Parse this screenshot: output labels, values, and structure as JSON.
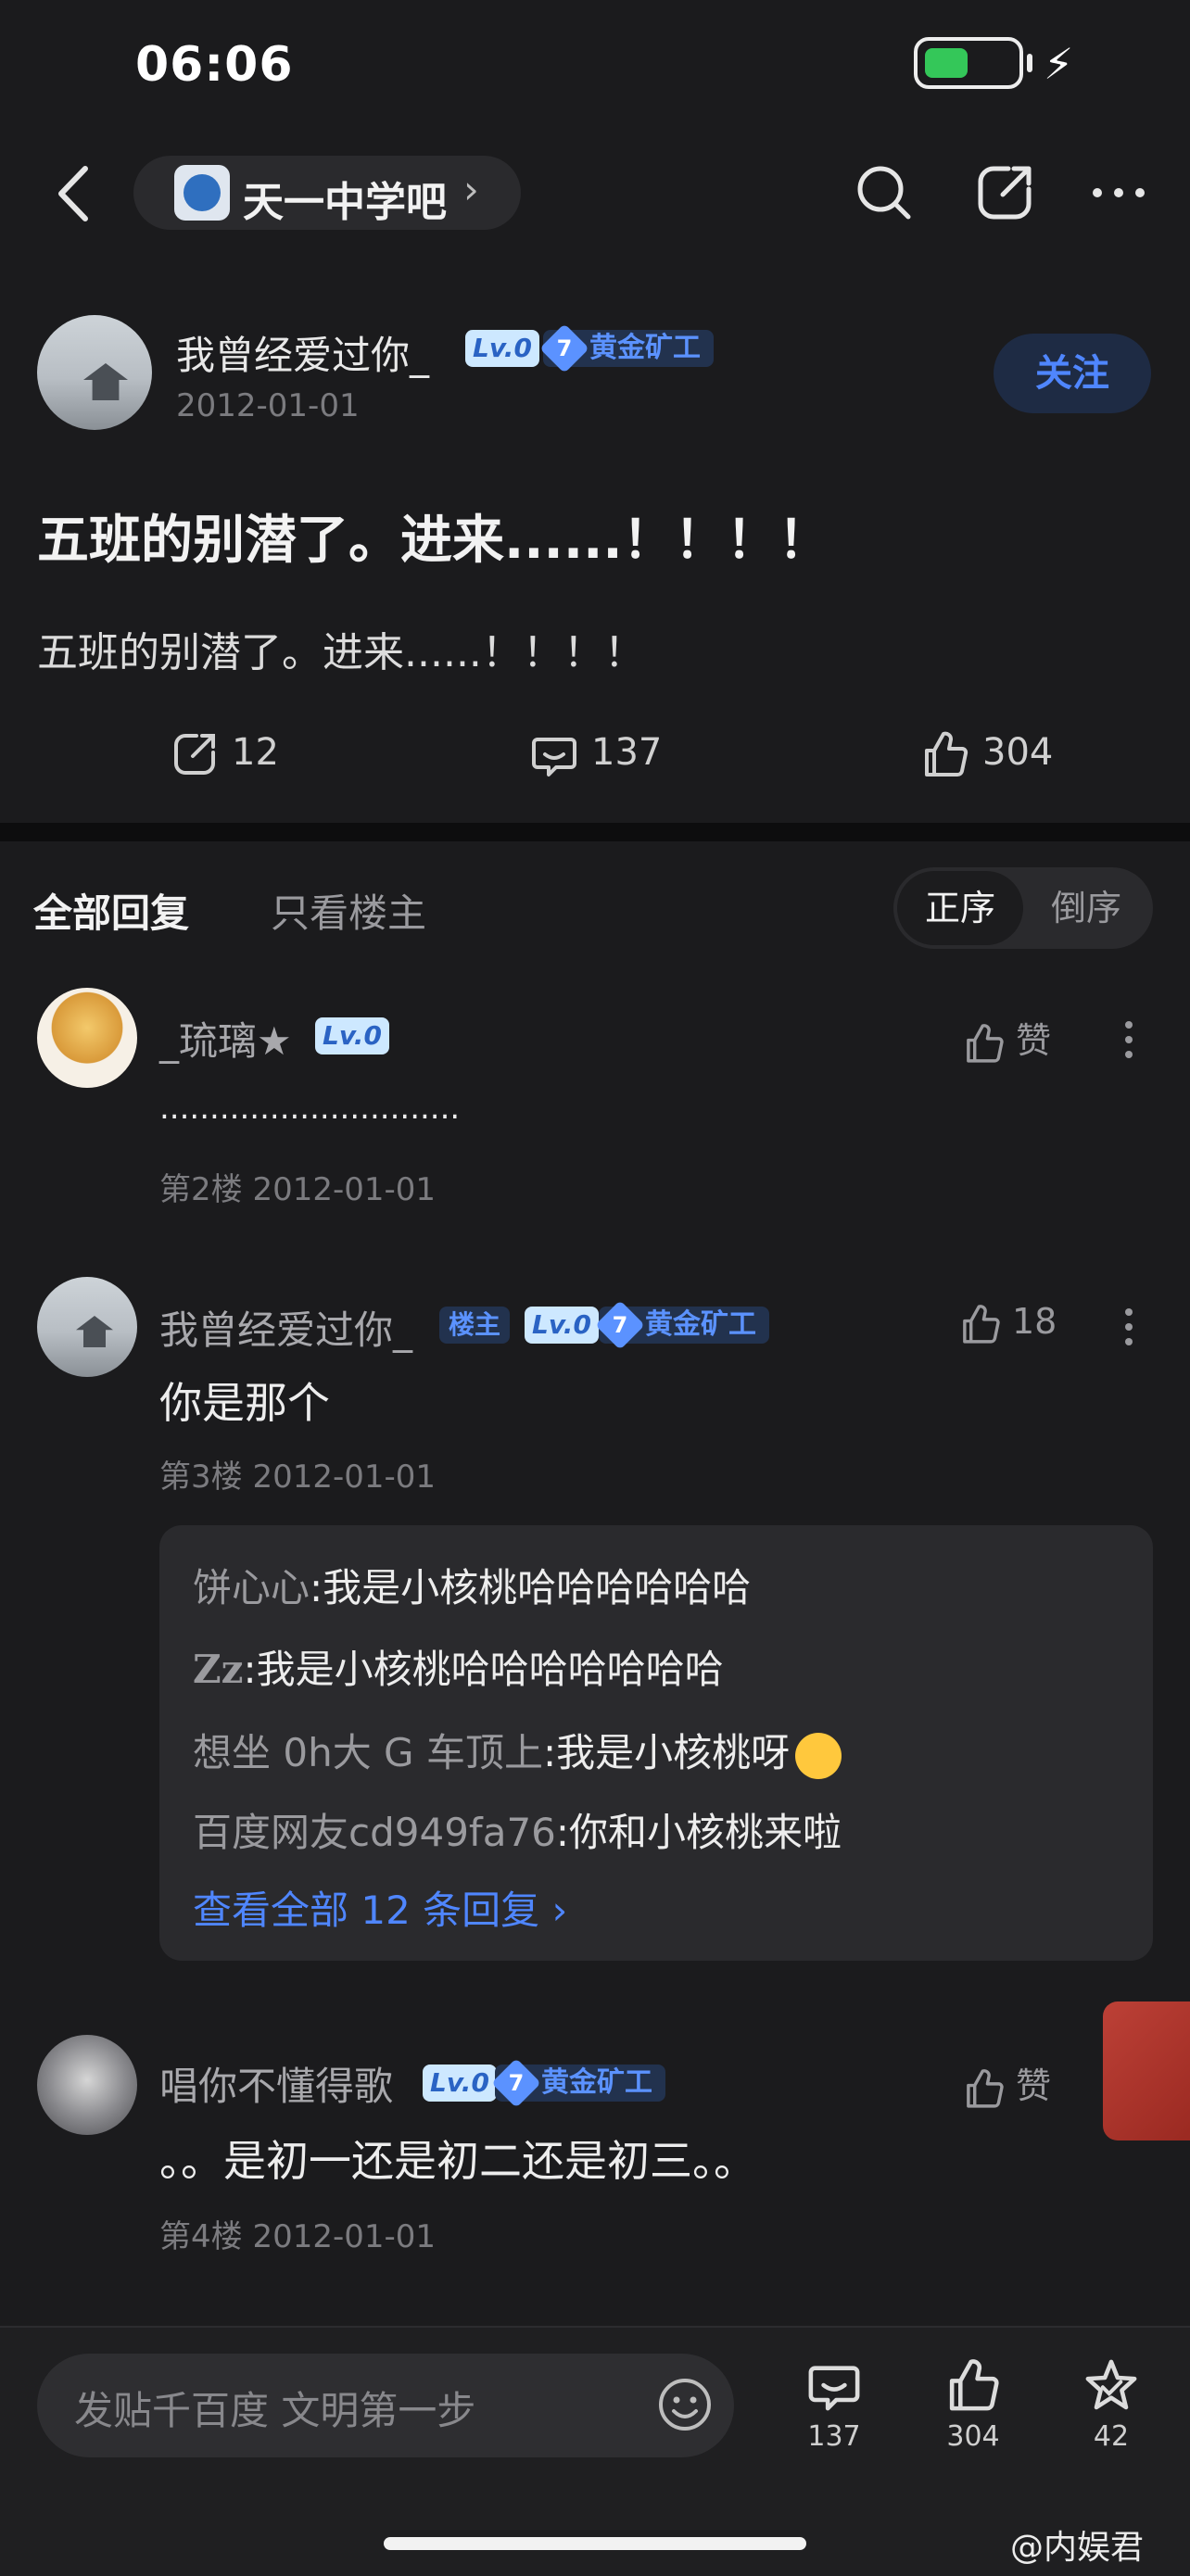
{
  "status": {
    "time": "06:06"
  },
  "nav": {
    "forum_name": "天一中学吧",
    "forum_arrow": "›"
  },
  "post": {
    "author": "我曾经爱过你_",
    "level": "Lv.0",
    "gold_level": "7",
    "gold_title": "黄金矿工",
    "date": "2012-01-01",
    "follow_label": "关注",
    "title": "五班的别潜了。进来......！！！！",
    "body": "五班的别潜了。进来......！！！！",
    "stats": {
      "shares": "12",
      "comments": "137",
      "likes": "304"
    }
  },
  "tabs": {
    "all": "全部回复",
    "host_only": "只看楼主",
    "sort_asc": "正序",
    "sort_desc": "倒序"
  },
  "replies": [
    {
      "name": "_琉璃★",
      "level": "Lv.0",
      "like": "赞",
      "text": "..............................",
      "meta": "第2楼  2012-01-01"
    },
    {
      "name": "我曾经爱过你_",
      "host_badge": "楼主",
      "level": "Lv.0",
      "gold_level": "7",
      "gold_title": "黄金矿工",
      "like": "18",
      "text": "你是那个",
      "meta": "第3楼  2012-01-01",
      "sub_replies": [
        {
          "user": "饼心心",
          "text": ":我是小核桃哈哈哈哈哈哈"
        },
        {
          "user": "Zz",
          "text": ":我是小核桃哈哈哈哈哈哈哈"
        },
        {
          "user": "想坐 0h大 G 车顶上",
          "text": ":我是小核桃呀"
        },
        {
          "user": "百度网友cd949fa76",
          "text": ":你和小核桃来啦"
        }
      ],
      "view_all": "查看全部 12 条回复 ›"
    },
    {
      "name": "唱你不懂得歌",
      "level": "Lv.0",
      "gold_level": "7",
      "gold_title": "黄金矿工",
      "like": "赞",
      "text": "。。是初一还是初二还是初三。。",
      "meta": "第4楼  2012-01-01"
    }
  ],
  "bottom": {
    "placeholder": "发贴千百度 文明第一步",
    "comments": "137",
    "likes": "304",
    "favorites": "42"
  },
  "watermark": "@内娱君"
}
